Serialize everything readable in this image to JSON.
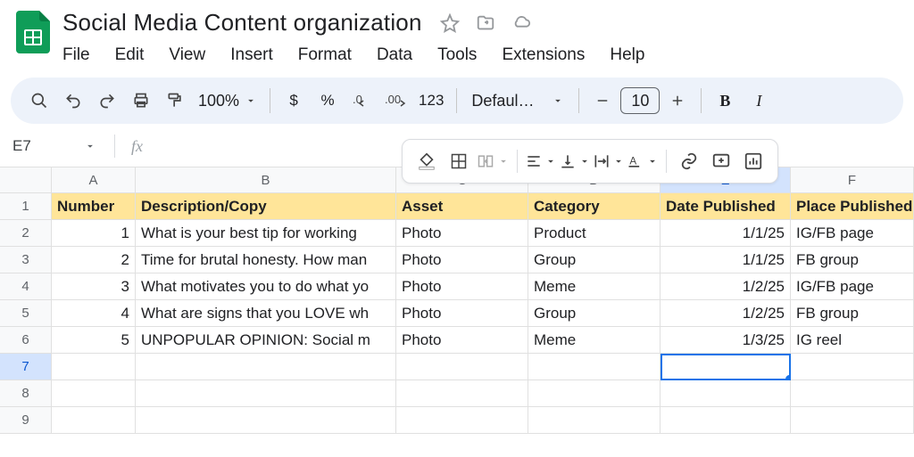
{
  "doc_title": "Social Media Content organization",
  "menubar": [
    "File",
    "Edit",
    "View",
    "Insert",
    "Format",
    "Data",
    "Tools",
    "Extensions",
    "Help"
  ],
  "toolbar": {
    "zoom": "100%",
    "font": "Defaul…",
    "font_size": "10",
    "fmt_123": "123",
    "fmt_dollar": "$",
    "fmt_percent": "%"
  },
  "namebox": "E7",
  "col_headers": [
    "A",
    "B",
    "C",
    "D",
    "E",
    "F"
  ],
  "row_numbers": [
    "1",
    "2",
    "3",
    "4",
    "5",
    "6",
    "7",
    "8",
    "9"
  ],
  "header_row": {
    "A": "Number",
    "B": "Description/Copy",
    "C": "Asset",
    "D": "Category",
    "E": "Date Published",
    "F": "Place Published"
  },
  "rows": [
    {
      "A": "1",
      "B": "What is your best tip for working ",
      "C": "Photo",
      "D": "Product",
      "E": "1/1/25",
      "F": "IG/FB page"
    },
    {
      "A": "2",
      "B": "Time for brutal honesty. How man",
      "C": "Photo",
      "D": "Group",
      "E": "1/1/25",
      "F": "FB group"
    },
    {
      "A": "3",
      "B": "What motivates you to do what yo",
      "C": "Photo",
      "D": "Meme",
      "E": "1/2/25",
      "F": "IG/FB page"
    },
    {
      "A": "4",
      "B": "What are signs that you LOVE wh",
      "C": "Photo",
      "D": "Group",
      "E": "1/2/25",
      "F": "FB group"
    },
    {
      "A": "5",
      "B": "UNPOPULAR OPINION: Social m",
      "C": "Photo",
      "D": "Meme",
      "E": "1/3/25",
      "F": "IG reel"
    }
  ],
  "active_cell": "E7"
}
